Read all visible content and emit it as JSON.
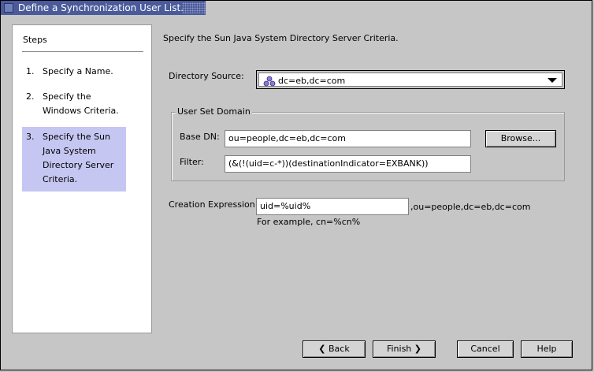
{
  "window": {
    "title": "Define a Synchronization User List."
  },
  "steps": {
    "title": "Steps",
    "items": [
      {
        "number": "1.",
        "label": "Specify a Name."
      },
      {
        "number": "2.",
        "label": "Specify the Windows Criteria."
      },
      {
        "number": "3.",
        "label": "Specify the Sun Java System Directory Server Criteria."
      }
    ],
    "active_index": 2
  },
  "main": {
    "title": "Specify the Sun Java System Directory Server Criteria.",
    "directory_source": {
      "label": "Directory Source:",
      "value": "dc=eb,dc=com",
      "icon": "directory-server-icon"
    },
    "user_set_domain": {
      "title": "User Set Domain",
      "base_dn_label": "Base DN:",
      "base_dn_value": "ou=people,dc=eb,dc=com",
      "browse_label": "Browse...",
      "filter_label": "Filter:",
      "filter_value": "(&(!(uid=c-*))(destinationIndicator=EXBANK))"
    },
    "creation_expression": {
      "label": "Creation Expression:",
      "value": "uid=%uid%",
      "suffix": ",ou=people,dc=eb,dc=com",
      "hint": "For example, cn=%cn%"
    }
  },
  "footer": {
    "back_label": "Back",
    "finish_label": "Finish",
    "cancel_label": "Cancel",
    "help_label": "Help"
  }
}
